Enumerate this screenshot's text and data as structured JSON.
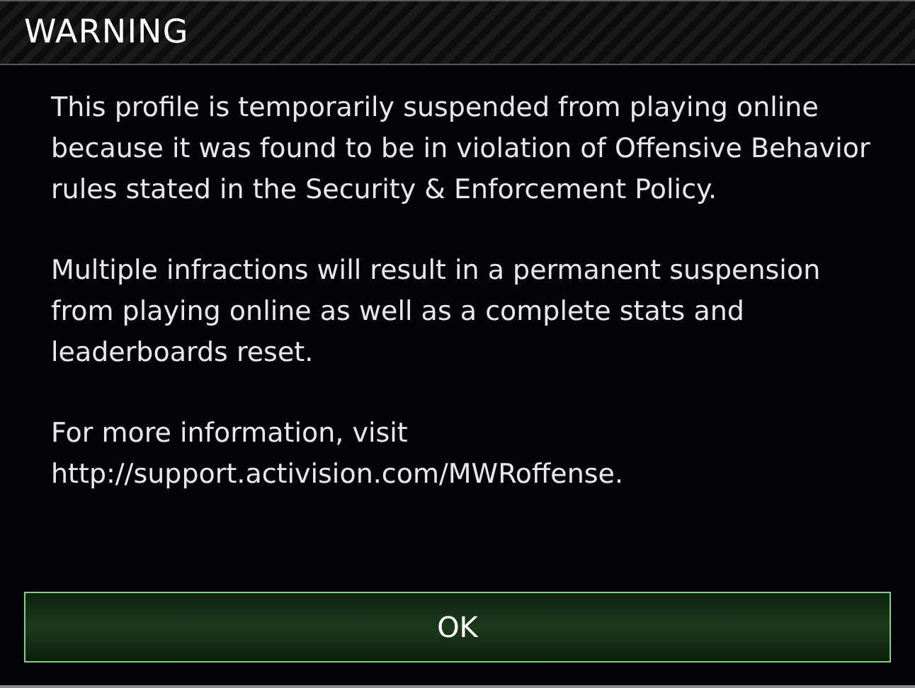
{
  "dialog": {
    "title": "WARNING",
    "paragraphs": [
      "This profile is temporarily suspended from playing online because it was found to be in violation of Offensive Behavior rules stated in the Security & Enforcement Policy.",
      "Multiple infractions will result in a permanent suspension from playing online as well as a complete stats and leaderboards reset.",
      "For more information, visit http://support.activision.com/MWRoffense."
    ],
    "buttons": [
      "OK"
    ]
  }
}
